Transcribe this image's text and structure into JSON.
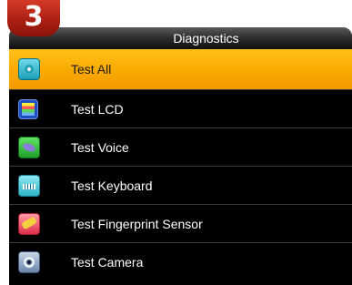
{
  "step_badge": "3",
  "header": {
    "title": "Diagnostics"
  },
  "menu": {
    "selected_index": 0,
    "selected_color": "#f9a900",
    "items": [
      {
        "label": "Test All",
        "icon": "test-all-icon"
      },
      {
        "label": "Test LCD",
        "icon": "lcd-icon"
      },
      {
        "label": "Test Voice",
        "icon": "voice-icon"
      },
      {
        "label": "Test Keyboard",
        "icon": "keyboard-icon"
      },
      {
        "label": "Test Fingerprint Sensor",
        "icon": "fingerprint-sensor-icon"
      },
      {
        "label": "Test Camera",
        "icon": "camera-icon"
      }
    ]
  }
}
